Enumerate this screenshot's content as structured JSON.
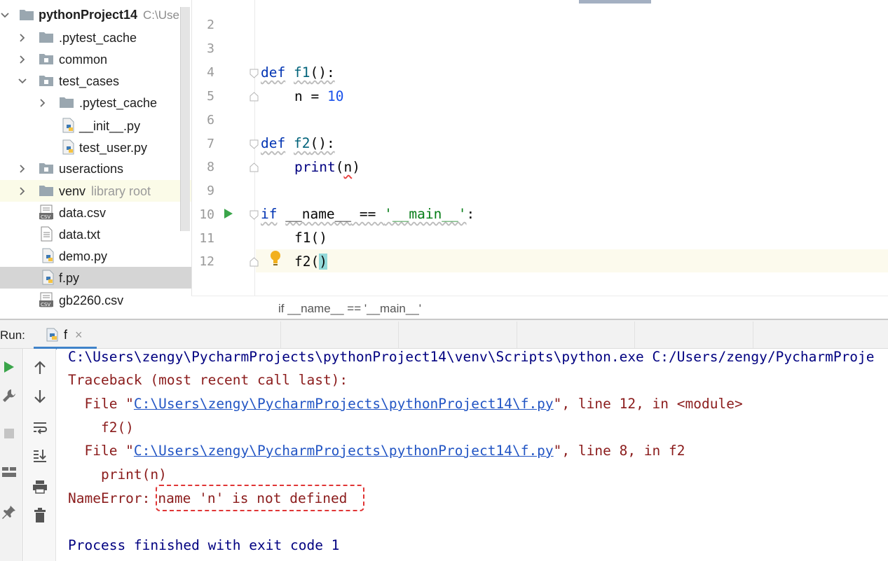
{
  "project": {
    "root_name": "pythonProject14",
    "root_path": "C:\\Users",
    "items": [
      {
        "label": ".pytest_cache",
        "type": "folder"
      },
      {
        "label": "common",
        "type": "package"
      },
      {
        "label": "test_cases",
        "type": "package"
      },
      {
        "label": ".pytest_cache",
        "type": "folder"
      },
      {
        "label": "__init__.py",
        "type": "python"
      },
      {
        "label": "test_user.py",
        "type": "python"
      },
      {
        "label": "useractions",
        "type": "package"
      },
      {
        "label": "venv",
        "hint": "library root",
        "type": "folder"
      },
      {
        "label": "data.csv",
        "type": "csv"
      },
      {
        "label": "data.txt",
        "type": "text"
      },
      {
        "label": "demo.py",
        "type": "python"
      },
      {
        "label": "f.py",
        "type": "python",
        "selected": true
      },
      {
        "label": "gb2260.csv",
        "type": "csv"
      }
    ]
  },
  "editor": {
    "line_numbers": [
      "2",
      "3",
      "4",
      "5",
      "6",
      "7",
      "8",
      "9",
      "10",
      "11",
      "12"
    ],
    "code": {
      "l4_kw": "def",
      "l4_fn": "f1",
      "l4_rest": "():",
      "l5_a": "n = ",
      "l5_num": "10",
      "l7_kw": "def",
      "l7_fn": "f2",
      "l7_rest": "():",
      "l8_fn": "print",
      "l8_open": "(",
      "l8_var": "n",
      "l8_close": ")",
      "l10_kw": "if",
      "l10_name": "__name__",
      "l10_op": " == ",
      "l10_str": "'__main__'",
      "l10_colon": ":",
      "l11": "f1()",
      "l12_a": "f2(",
      "l12_b": ")"
    },
    "breadcrumb": "if __name__ == '__main__'"
  },
  "run": {
    "title": "Run:",
    "tab_label": "f",
    "close_glyph": "×"
  },
  "console": {
    "cmd": "C:\\Users\\zengy\\PycharmProjects\\pythonProject14\\venv\\Scripts\\python.exe C:/Users/zengy/PycharmProje",
    "traceback": "Traceback (most recent call last):",
    "file1_pre": "  File \"",
    "file1_link": "C:\\Users\\zengy\\PycharmProjects\\pythonProject14\\f.py",
    "file1_post": "\", line 12, in <module>",
    "code1": "    f2()",
    "file2_pre": "  File \"",
    "file2_link": "C:\\Users\\zengy\\PycharmProjects\\pythonProject14\\f.py",
    "file2_post": "\", line 8, in f2",
    "code2": "    print(n)",
    "error_type": "NameError:",
    "error_msg": "name 'n' is not defined",
    "finished": "Process finished with exit code 1"
  },
  "colors": {
    "selection": "#d5d5d5",
    "accent_tab": "#4083c9",
    "error_text": "#8b1c1c",
    "error_box": "#e03535",
    "link": "#2255c4"
  }
}
